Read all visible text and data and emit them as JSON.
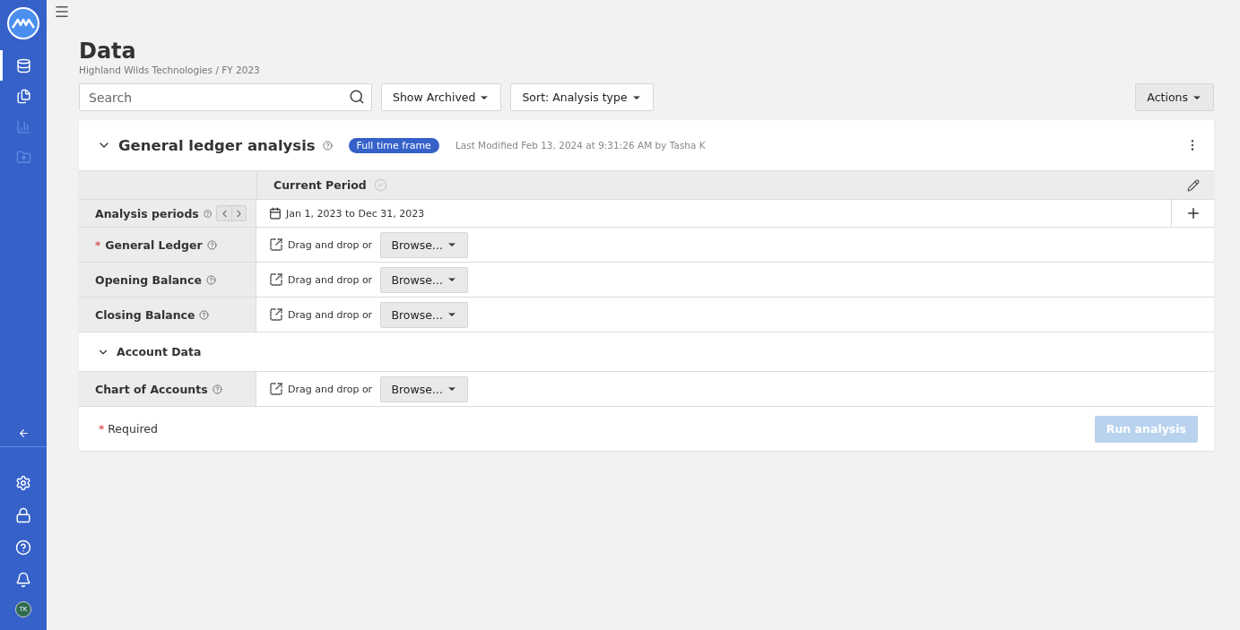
{
  "sidebar": {
    "nav": [
      {
        "kind": "data",
        "selected": true,
        "disabled": false
      },
      {
        "kind": "files",
        "selected": false,
        "disabled": false
      },
      {
        "kind": "chart",
        "selected": false,
        "disabled": true
      },
      {
        "kind": "export",
        "selected": false,
        "disabled": true
      }
    ],
    "tools": [
      {
        "kind": "settings"
      },
      {
        "kind": "lock"
      },
      {
        "kind": "help"
      },
      {
        "kind": "bell"
      }
    ],
    "avatar": "TK"
  },
  "page": {
    "title": "Data",
    "breadcrumb": "Highland Wilds Technologies / FY 2023"
  },
  "toolbar": {
    "search": {
      "placeholder": "Search"
    },
    "filters": [
      "Show Archived",
      "Sort: Analysis type"
    ],
    "actions": "Actions"
  },
  "analysis": {
    "title": "General ledger analysis",
    "expanded": true,
    "badge": "Full time frame",
    "modified": "Last Modified Feb 13, 2024 at 9:31:26 AM by Tasha K",
    "column": "Current Period",
    "period_row": {
      "label": "Analysis periods",
      "range": "Jan 1, 2023 to Dec 31, 2023"
    },
    "rows": [
      {
        "label": "General Ledger",
        "required_mark": "*",
        "drop_text": "Drag and drop or",
        "browse": "Browse..."
      },
      {
        "label": "Opening Balance",
        "drop_text": "Drag and drop or",
        "browse": "Browse..."
      },
      {
        "label": "Closing Balance",
        "drop_text": "Drag and drop or",
        "browse": "Browse..."
      }
    ],
    "sections": [
      {
        "title": "Account Data",
        "expanded": true,
        "rows": [
          {
            "label": "Chart of Accounts",
            "drop_text": "Drag and drop or",
            "browse": "Browse..."
          }
        ]
      }
    ],
    "footer": {
      "required_mark": "*",
      "required_label": "Required",
      "run": {
        "label": "Run analysis",
        "disabled": true
      }
    }
  }
}
